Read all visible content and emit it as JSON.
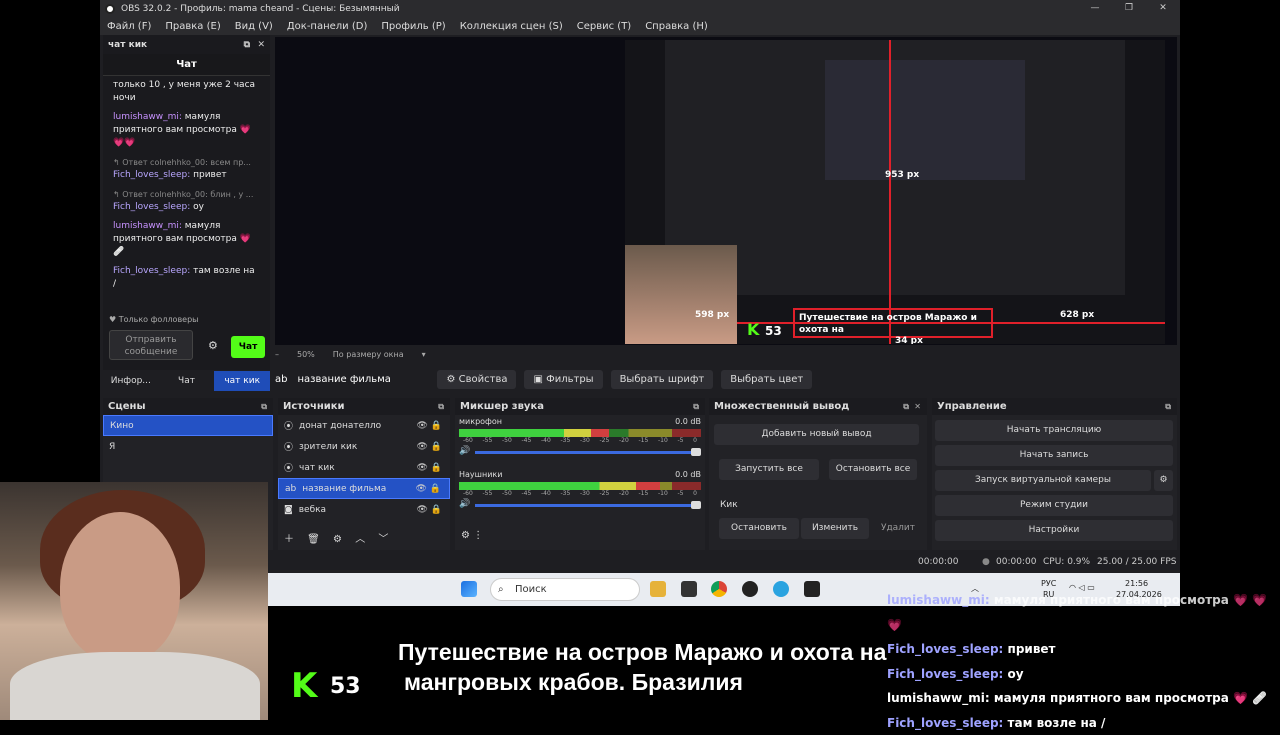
{
  "window": {
    "title": "OBS 32.0.2 - Профиль: mama cheand - Сцены: Безымянный",
    "controls": [
      "—",
      "❐",
      "✕"
    ]
  },
  "menu": [
    "Файл (F)",
    "Правка (E)",
    "Вид (V)",
    "Док-панели (D)",
    "Профиль (P)",
    "Коллекция сцен (S)",
    "Сервис (T)",
    "Справка (H)"
  ],
  "chat_dock": {
    "header": "чат кик",
    "title": "Чат",
    "messages": [
      {
        "user": "",
        "text": "только 10 , у меня уже 2 часа ночи"
      },
      {
        "user": "lumishaww_mi:",
        "text": " мамуля приятного вам просмотра 💗 💗💗"
      },
      {
        "reply": "↰ Ответ colnehhko_00: всем пр...",
        "user": "Fich_loves_sleep:",
        "text": " привет"
      },
      {
        "reply": "↰ Ответ colnehhko_00: блин , у ...",
        "user": "Fich_loves_sleep:",
        "text": " оу"
      },
      {
        "user": "lumishaww_mi:",
        "text": " мамуля приятного вам просмотра 💗 🩹"
      },
      {
        "user": "Fich_loves_sleep:",
        "text": " там возле на /"
      }
    ],
    "followers_only": "♥ Только фолловеры",
    "send_placeholder": "Отправить сообщение",
    "chat_button": "Чат"
  },
  "dock_tabs": [
    "Инфор...",
    "Чат",
    "чат кик"
  ],
  "preview": {
    "zoom": "50%",
    "fit": "По размеру окна",
    "dim1": "953 px",
    "dim2": "628 px",
    "dim3": "598 px",
    "dim4": "34 px"
  },
  "source_toolbar": {
    "selected": "название фильма",
    "properties": "⚙ Свойства",
    "filters": "▣ Фильтры",
    "font": "Выбрать шрифт",
    "color": "Выбрать цвет"
  },
  "scenes": {
    "title": "Сцены",
    "items": [
      "Кино",
      "Я"
    ]
  },
  "sources": {
    "title": "Источники",
    "items": [
      "донат донателло",
      "зрители кик",
      "чат кик",
      "название фильма",
      "вебка"
    ]
  },
  "mixer": {
    "title": "Микшер звука",
    "channels": [
      {
        "name": "микрофон",
        "db": "0.0 dB",
        "level": 0.62
      },
      {
        "name": "Наушники",
        "db": "0.0 dB",
        "level": 0.83
      }
    ],
    "scale": [
      "-60",
      "-55",
      "-50",
      "-45",
      "-40",
      "-35",
      "-30",
      "-25",
      "-20",
      "-15",
      "-10",
      "-5",
      "0"
    ]
  },
  "multi": {
    "title": "Множественный вывод",
    "add": "Добавить новый вывод",
    "start_all": "Запустить все",
    "stop_all": "Остановить все",
    "target": "Кик",
    "stop": "Остановить",
    "edit": "Изменить",
    "delete": "Удалит"
  },
  "controls": {
    "title": "Управление",
    "buttons": [
      "Начать трансляцию",
      "Начать запись",
      "Запуск виртуальной камеры",
      "Режим студии",
      "Настройки"
    ]
  },
  "status": {
    "t1": "00:00:00",
    "t2": "00:00:00",
    "cpu": "CPU: 0.9%",
    "fps": "25.00 / 25.00 FPS"
  },
  "taskbar": {
    "search": "Поиск",
    "lang1": "РУС",
    "lang2": "RU",
    "time": "21:56",
    "date": "27.04.2026"
  },
  "overlay": {
    "viewers": "53",
    "title_line1": "Путешествие на остров Маражо и охота на",
    "title_line2": "мангровых крабов. Бразилия",
    "chat": [
      {
        "user": "lumishaww_mi:",
        "text": " мамуля приятного вам просмотра 💗 💗 💗"
      },
      {
        "user": "Fich_loves_sleep:",
        "text": " привет"
      },
      {
        "user": "Fich_loves_sleep:",
        "text": " оу"
      },
      {
        "user": "lumishaww_mi:",
        "text": " мамуля приятного вам просмотра 💗 🩹"
      },
      {
        "user": "Fich_loves_sleep:",
        "text": " там возле на /"
      }
    ]
  },
  "colors": {
    "kick_green": "#53fc18",
    "accent_blue": "#2452c5"
  }
}
